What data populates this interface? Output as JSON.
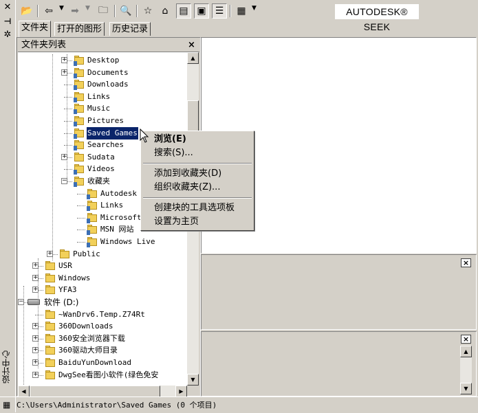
{
  "toolbar": {
    "brand": "AUTODESK® SEEK",
    "buttons": [
      "open-folder",
      "back",
      "forward",
      "up-level",
      "search",
      "favorites",
      "home",
      "tree-toggle",
      "preview",
      "description",
      "views"
    ]
  },
  "side_title": "设计中心",
  "tabs": [
    {
      "label": "文件夹",
      "active": true
    },
    {
      "label": "打开的图形",
      "active": false
    },
    {
      "label": "历史记录",
      "active": false
    }
  ],
  "tree": {
    "header": "文件夹列表",
    "close_glyph": "×",
    "rows": [
      {
        "label": "Desktop",
        "level": 4,
        "expander": "+",
        "icon": "folder-sys"
      },
      {
        "label": "Documents",
        "level": 4,
        "expander": "+",
        "icon": "folder-sys"
      },
      {
        "label": "Downloads",
        "level": 4,
        "expander": "",
        "icon": "folder-sys"
      },
      {
        "label": "Links",
        "level": 4,
        "expander": "",
        "icon": "folder-sys"
      },
      {
        "label": "Music",
        "level": 4,
        "expander": "",
        "icon": "folder-sys"
      },
      {
        "label": "Pictures",
        "level": 4,
        "expander": "",
        "icon": "folder-sys"
      },
      {
        "label": "Saved Games",
        "level": 4,
        "expander": "",
        "icon": "folder-sys",
        "selected": true
      },
      {
        "label": "Searches",
        "level": 4,
        "expander": "",
        "icon": "folder-sys"
      },
      {
        "label": "Sudata",
        "level": 4,
        "expander": "+",
        "icon": "folder"
      },
      {
        "label": "Videos",
        "level": 4,
        "expander": "",
        "icon": "folder-sys"
      },
      {
        "label": "收藏夹",
        "level": 4,
        "expander": "-",
        "icon": "folder-sys"
      },
      {
        "label": "Autodesk",
        "level": 5,
        "expander": "",
        "icon": "folder-sys"
      },
      {
        "label": "Links",
        "level": 5,
        "expander": "",
        "icon": "folder-sys"
      },
      {
        "label": "Microsoft",
        "level": 5,
        "expander": "",
        "icon": "folder-sys"
      },
      {
        "label": "MSN 网站",
        "level": 5,
        "expander": "",
        "icon": "folder-sys"
      },
      {
        "label": "Windows Live",
        "level": 5,
        "expander": "",
        "icon": "folder-sys"
      },
      {
        "label": "Public",
        "level": 3,
        "expander": "+",
        "icon": "folder"
      },
      {
        "label": "USR",
        "level": 2,
        "expander": "+",
        "icon": "folder"
      },
      {
        "label": "Windows",
        "level": 2,
        "expander": "+",
        "icon": "folder"
      },
      {
        "label": "YFA3",
        "level": 2,
        "expander": "+",
        "icon": "folder"
      },
      {
        "label": "软件 (D:)",
        "level": 1,
        "expander": "-",
        "icon": "drive"
      },
      {
        "label": "~WanDrv6.Temp.Z74Rt",
        "level": 2,
        "expander": "",
        "icon": "folder"
      },
      {
        "label": "360Downloads",
        "level": 2,
        "expander": "+",
        "icon": "folder"
      },
      {
        "label": "360安全浏览器下载",
        "level": 2,
        "expander": "+",
        "icon": "folder"
      },
      {
        "label": "360驱动大师目录",
        "level": 2,
        "expander": "+",
        "icon": "folder"
      },
      {
        "label": "BaiduYunDownload",
        "level": 2,
        "expander": "+",
        "icon": "folder"
      },
      {
        "label": "DwgSee看图小软件(绿色免安",
        "level": 2,
        "expander": "+",
        "icon": "folder"
      }
    ]
  },
  "context_menu": {
    "items": [
      {
        "label": "浏览(E)",
        "bold": true
      },
      {
        "label": "搜索(S)...",
        "bold": false
      },
      {
        "separator": true
      },
      {
        "label": "添加到收藏夹(D)",
        "bold": false
      },
      {
        "label": "组织收藏夹(Z)...",
        "bold": false
      },
      {
        "separator": true
      },
      {
        "label": "创建块的工具选项板",
        "bold": false
      },
      {
        "label": "设置为主页",
        "bold": false
      }
    ]
  },
  "panels": {
    "preview_close": "×",
    "description_close": "×"
  },
  "status": {
    "path": "C:\\Users\\Administrator\\Saved Games (0 个项目)"
  }
}
